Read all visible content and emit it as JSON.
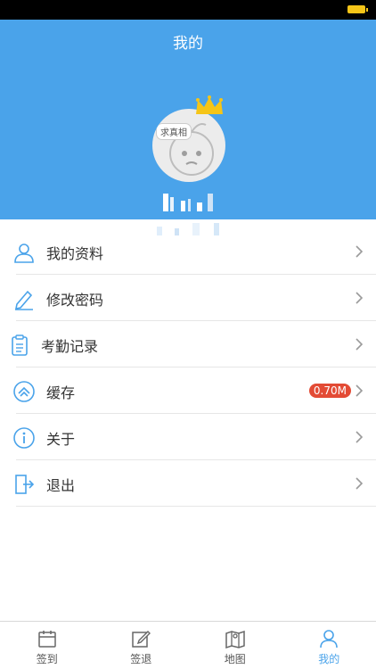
{
  "header": {
    "title": "我的"
  },
  "profile": {
    "avatar_badge": "求真相"
  },
  "menu": {
    "items": [
      {
        "label": "我的资料",
        "icon": "user-icon"
      },
      {
        "label": "修改密码",
        "icon": "pencil-icon"
      },
      {
        "label": "考勤记录",
        "icon": "clipboard-icon"
      },
      {
        "label": "缓存",
        "icon": "cache-icon",
        "badge": "0.70M"
      },
      {
        "label": "关于",
        "icon": "info-icon"
      },
      {
        "label": "退出",
        "icon": "logout-icon"
      }
    ]
  },
  "tabbar": {
    "tabs": [
      {
        "label": "签到",
        "icon": "calendar-icon"
      },
      {
        "label": "签退",
        "icon": "edit-icon"
      },
      {
        "label": "地图",
        "icon": "map-icon"
      },
      {
        "label": "我的",
        "icon": "person-icon",
        "active": true
      }
    ]
  },
  "colors": {
    "primary": "#4aa3ea",
    "badge": "#e34b35",
    "crown": "#f5c518"
  }
}
